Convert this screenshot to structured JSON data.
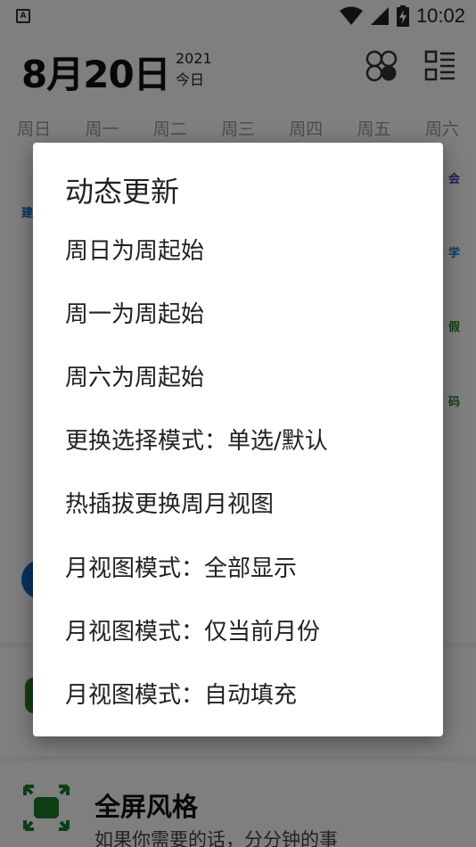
{
  "status_bar": {
    "app_icon_letter": "A",
    "time": "10:02"
  },
  "header": {
    "date": "8月20日",
    "year": "2021",
    "today": "今日"
  },
  "week_days": [
    "周日",
    "周一",
    "周二",
    "周三",
    "周四",
    "周五",
    "周六"
  ],
  "background_labels": {
    "right_1": "会",
    "right_2": "学",
    "right_3": "假",
    "right_4": "码",
    "left_1": "建"
  },
  "fullscreen_card": {
    "title": "全屏风格",
    "subtitle": "如果你需要的话，分分钟的事"
  },
  "dialog": {
    "title": "动态更新",
    "items": [
      "周日为周起始",
      "周一为周起始",
      "周六为周起始",
      "更换选择模式：单选/默认",
      "热插拔更换周月视图",
      "月视图模式：全部显示",
      "月视图模式：仅当前月份",
      "月视图模式：自动填充"
    ]
  },
  "colors": {
    "scrim": "#000000",
    "accent_blue": "#1565c0",
    "accent_green": "#2e7d32",
    "label_purple": "#3f3fa0"
  }
}
